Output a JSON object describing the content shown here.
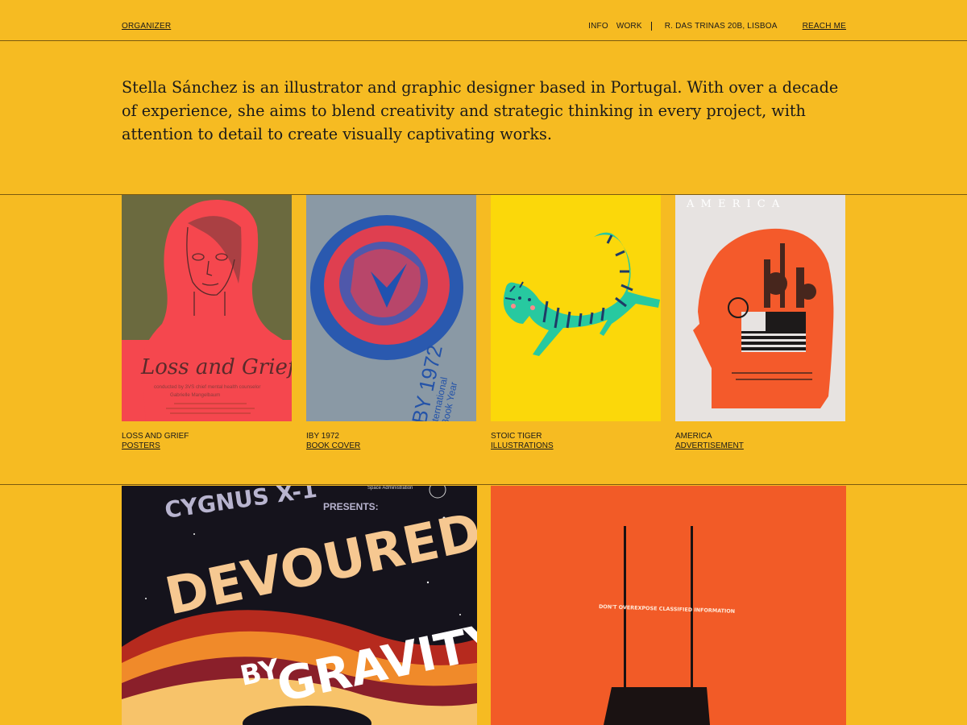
{
  "header": {
    "brand": "ORGANIZER",
    "nav": [
      "INFO",
      "WORK"
    ],
    "address": "R. DAS TRINAS 20B, LISBOA",
    "cta": "REACH ME"
  },
  "intro": "Stella Sánchez is an illustrator and graphic designer based in Portugal. With over a decade of experience, she aims to blend creativity and strategic thinking in every project, with attention to detail to create visually captivating works.",
  "projects": [
    {
      "title": "LOSS AND GRIEF",
      "category": "POSTERS",
      "art": {
        "heading": "Loss and Grief",
        "line1": "conducted by 3VS chief mental health counselor",
        "line2": "Gabrielle Mangelbaum"
      }
    },
    {
      "title": "IBY 1972",
      "category": "BOOK COVER",
      "art": {
        "year": "IBY 1972",
        "line1": "International",
        "line2": "Book Year"
      }
    },
    {
      "title": "STOIC TIGER",
      "category": "ILLUSTRATIONS",
      "art": {}
    },
    {
      "title": "AMERICA",
      "category": "ADVERTISEMENT",
      "art": {
        "heading": "A M E R I C A"
      }
    }
  ],
  "featured": [
    {
      "art": {
        "top": "CYGNUS X-1",
        "presents": "PRESENTS:",
        "agency": "Space Administration",
        "title1": "DEVOURED",
        "title2": "BY",
        "title3": "GRAVITY"
      }
    },
    {
      "art": {
        "caption": "DON'T OVEREXPOSE CLASSIFIED INFORMATION"
      }
    }
  ],
  "colors": {
    "background": "#f6bb22",
    "text": "#1a1a1a",
    "rule": "#7a5a10"
  }
}
